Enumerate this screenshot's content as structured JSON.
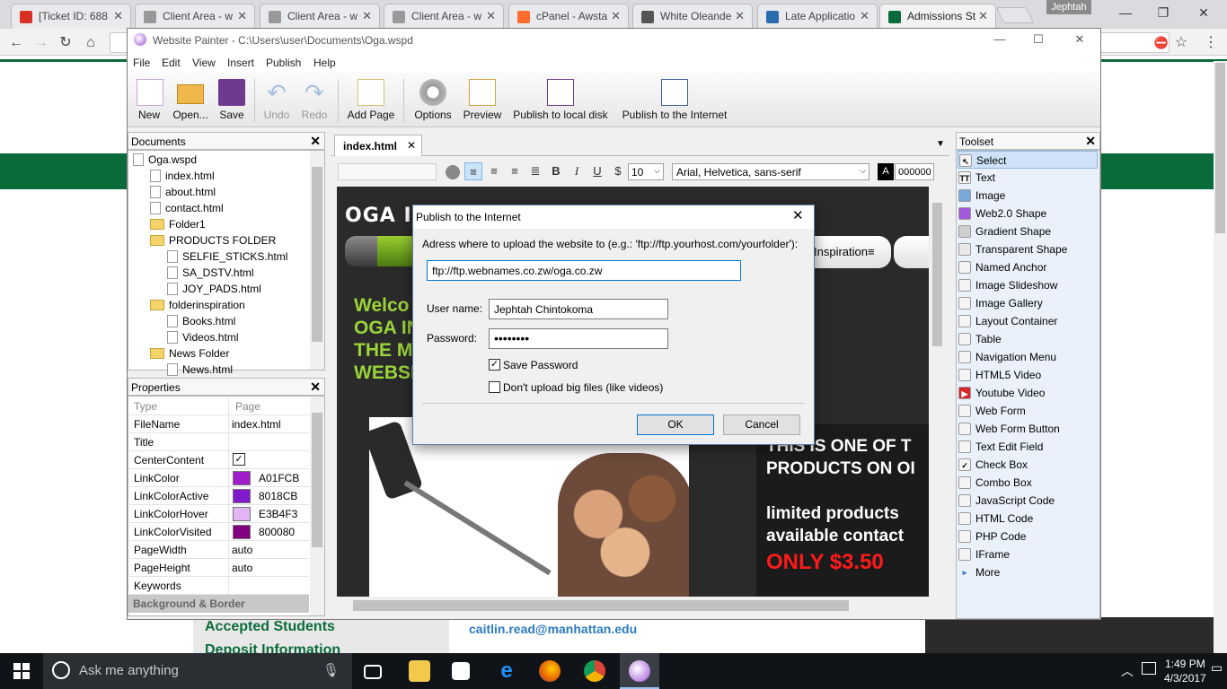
{
  "browser": {
    "tabs": [
      {
        "label": "[Ticket ID: 688",
        "favicon": "gmail-icon",
        "color": "#d93025"
      },
      {
        "label": "Client Area - w",
        "favicon": "page-icon",
        "color": "#999999"
      },
      {
        "label": "Client Area - w",
        "favicon": "page-icon",
        "color": "#999999"
      },
      {
        "label": "Client Area - w",
        "favicon": "page-icon",
        "color": "#999999"
      },
      {
        "label": "cPanel - Awsta",
        "favicon": "cpanel-icon",
        "color": "#ff6c2c"
      },
      {
        "label": "White Oleande",
        "favicon": "wikipedia-icon",
        "color": "#555555"
      },
      {
        "label": "Late Applicatio",
        "favicon": "manhattan-icon",
        "color": "#2b6cb0"
      },
      {
        "label": "Admissions St",
        "favicon": "jaspers-shield-icon",
        "color": "#0a6b3a"
      }
    ],
    "user_chip": "Jephtah"
  },
  "webpage": {
    "left_link_1": "Accepted Students",
    "left_link_2": "Deposit Information",
    "email": "caitlin.read@manhattan.edu"
  },
  "app": {
    "title": "Website Painter - C:\\Users\\user\\Documents\\Oga.wspd",
    "menu": [
      "File",
      "Edit",
      "View",
      "Insert",
      "Publish",
      "Help"
    ],
    "toolbar": [
      "New",
      "Open...",
      "Save",
      "Undo",
      "Redo",
      "Add Page",
      "Options",
      "Preview",
      "Publish to local disk",
      "Publish to the Internet"
    ]
  },
  "documents": {
    "title": "Documents",
    "tree": [
      {
        "label": "Oga.wspd",
        "type": "project"
      },
      {
        "label": "index.html",
        "type": "file"
      },
      {
        "label": "about.html",
        "type": "file"
      },
      {
        "label": "contact.html",
        "type": "file"
      },
      {
        "label": "Folder1",
        "type": "folder"
      },
      {
        "label": "PRODUCTS FOLDER",
        "type": "folder"
      },
      {
        "label": "SELFIE_STICKS.html",
        "type": "file"
      },
      {
        "label": "SA_DSTV.html",
        "type": "file"
      },
      {
        "label": "JOY_PADS.html",
        "type": "file"
      },
      {
        "label": "folderinspiration",
        "type": "folder"
      },
      {
        "label": "Books.html",
        "type": "file"
      },
      {
        "label": "Videos.html",
        "type": "file"
      },
      {
        "label": "News Folder",
        "type": "folder"
      },
      {
        "label": "News.html",
        "type": "file"
      }
    ]
  },
  "properties": {
    "title": "Properties",
    "col_type": "Type",
    "col_page": "Page",
    "rows": [
      {
        "key": "FileName",
        "value": "index.html"
      },
      {
        "key": "Title",
        "value": ""
      },
      {
        "key": "CenterContent",
        "value": "✓"
      },
      {
        "key": "LinkColor",
        "value": "A01FCB",
        "swatch": "#A01FCB"
      },
      {
        "key": "LinkColorActive",
        "value": "8018CB",
        "swatch": "#8018CB"
      },
      {
        "key": "LinkColorHover",
        "value": "E3B4F3",
        "swatch": "#E3B4F3"
      },
      {
        "key": "LinkColorVisited",
        "value": "800080",
        "swatch": "#800080"
      },
      {
        "key": "PageWidth",
        "value": "auto"
      },
      {
        "key": "PageHeight",
        "value": "auto"
      },
      {
        "key": "Keywords",
        "value": ""
      }
    ],
    "section": "Background & Border"
  },
  "editor": {
    "tab": "index.html",
    "font_size": "10",
    "font_family": "Arial, Helvetica, sans-serif",
    "text_color": "000000",
    "site_heading": "OGA INT",
    "nav_item": "Inspiration≡",
    "welcome": [
      "Welco",
      "OGA IN",
      "THE M",
      "WEBSI"
    ],
    "promo1": "THIS IS ONE OF T",
    "promo2": "PRODUCTS ON OI",
    "promo3": "limited products",
    "promo4": "available contact",
    "price": "ONLY $3.50"
  },
  "toolset": {
    "title": "Toolset",
    "items": [
      "Select",
      "Text",
      "Image",
      "Web2.0 Shape",
      "Gradient Shape",
      "Transparent Shape",
      "Named Anchor",
      "Image Slideshow",
      "Image Gallery",
      "Layout Container",
      "Table",
      "Navigation Menu",
      "HTML5 Video",
      "Youtube Video",
      "Web Form",
      "Web Form Button",
      "Text Edit Field",
      "Check Box",
      "Combo Box",
      "JavaScript Code",
      "HTML Code",
      "PHP Code",
      "IFrame",
      "More"
    ]
  },
  "dialog": {
    "title": "Publish to the Internet",
    "address_label": "Adress where to upload the website to (e.g.: 'ftp://ftp.yourhost.com/yourfolder'):",
    "address_value": "ftp://ftp.webnames.co.zw/oga.co.zw",
    "username_label": "User name:",
    "username_value": "Jephtah Chintokoma",
    "password_label": "Password:",
    "password_value": "••••••••",
    "save_password_label": "Save Password",
    "save_password_checked": "✓",
    "no_big_files_label": "Don't upload big files (like videos)",
    "ok": "OK",
    "cancel": "Cancel"
  },
  "taskbar": {
    "search_placeholder": "Ask me anything",
    "time": "1:49 PM",
    "date": "4/3/2017"
  }
}
